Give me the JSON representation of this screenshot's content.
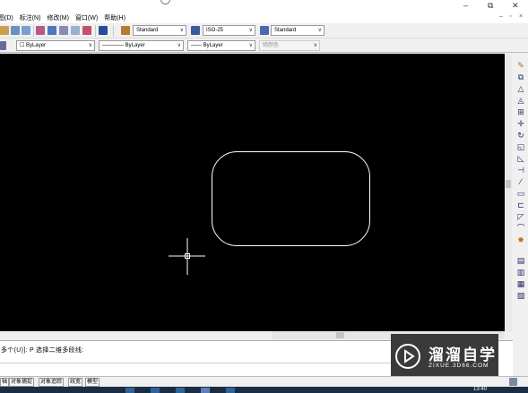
{
  "menu": [
    "图(D)",
    "标注(N)",
    "修改(M)",
    "窗口(W)",
    "帮助(H)"
  ],
  "window_controls": {
    "minimize": "–",
    "maximize": "⧉",
    "close": "✕"
  },
  "mdi_controls": {
    "minimize": "–",
    "restore": "▫",
    "close": "×"
  },
  "styles": {
    "text_style": "Standard",
    "dim_style": "ISO-25",
    "table_style": "Standard"
  },
  "properties": {
    "layer": "ByLayer",
    "color_label": "☐ ByLayer",
    "linetype": "———— ByLayer",
    "lineweight": "—— ByLayer",
    "plotstyle": "随颜色"
  },
  "command": {
    "history": "多个(U)]: P 选择二维多段线:"
  },
  "status_buttons": [
    "轴",
    "对象捕捉",
    "对象追踪",
    "线宽",
    "模型"
  ],
  "watermark": {
    "title": "溜溜自学",
    "subtitle": "ZIXUE.3D66.COM"
  },
  "clock": "13:40",
  "colors": {
    "canvas": "#000000",
    "entity": "#ffffff",
    "watermark_bg": "#3a3a3a"
  },
  "modify_tools": [
    "erase-icon",
    "copy-icon",
    "mirror-icon",
    "offset-icon",
    "array-icon",
    "move-icon",
    "rotate-icon",
    "scale-icon",
    "stretch-icon",
    "trim-icon",
    "extend-icon",
    "break-icon",
    "join-icon",
    "chamfer-icon",
    "fillet-icon",
    "explode-icon"
  ]
}
